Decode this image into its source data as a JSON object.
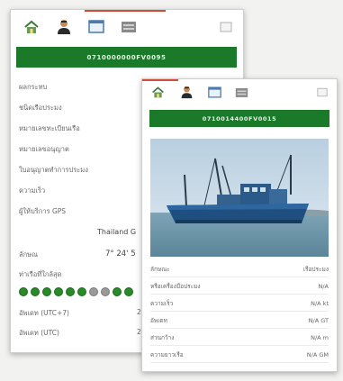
{
  "colors": {
    "accent_green": "#1a7a2a",
    "accent_red": "#d64a3a",
    "panel_bg": "#ffffff",
    "page_bg": "#f2f2f0"
  },
  "icons": [
    "home-icon",
    "person-icon",
    "window-icon",
    "folder-icon",
    "minimize-icon"
  ],
  "back_panel": {
    "vessel_id": "0710000000FV0095",
    "rows": [
      "ผลกระทบ",
      "ชนิดเรือประมง",
      "หมายเลขทะเบียนเรือ",
      "หมายเลขอนุญาต",
      "ใบอนุญาตทำการประมง",
      "ความเร็ว",
      "ผู้ให้บริการ GPS"
    ],
    "location_label": "Thailand G",
    "coord_label": "ลักษณ",
    "coord_value": "7° 24' 5",
    "nearest_port": "ท่าเรือที่ใกล้สุด",
    "status_dots": [
      "green",
      "green",
      "green",
      "green",
      "green",
      "green",
      "grey",
      "grey",
      "green",
      "green"
    ],
    "time_rows": [
      {
        "label": "อัพเดท (UTC+7)",
        "value": "2"
      },
      {
        "label": "อัพเดท (UTC)",
        "value": "2"
      }
    ]
  },
  "front_panel": {
    "vessel_id": "0710014400FV0015",
    "photo_alt": "fishing-vessel",
    "fields": [
      {
        "label": "ลักษณะ",
        "value": "เรือประมง"
      },
      {
        "label": "หรือเครื่องมือประมง",
        "value": "N/A"
      },
      {
        "label": "ความเร็ว",
        "value": "N/A kt"
      },
      {
        "label": "อัพเดท",
        "value": "N/A GT"
      },
      {
        "label": "ส่วนกว้าง",
        "value": "N/A m"
      },
      {
        "label": "ความยาวเรือ",
        "value": "N/A GM"
      }
    ]
  }
}
